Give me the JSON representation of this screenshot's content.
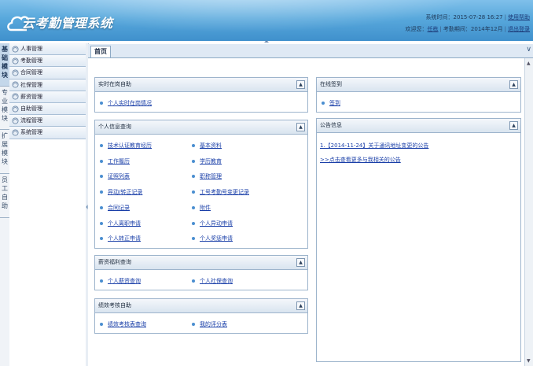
{
  "header": {
    "app_title": "云考勤管理系统",
    "system_time_label": "系统时间：",
    "system_time": "2015-07-28 16:27",
    "help_link": "使用帮助",
    "welcome_label": "欢迎您：",
    "user_name": "任栋",
    "period_label": "考勤期间：",
    "period": "2014年12月",
    "logout_link": "退出登录"
  },
  "left_tabs": [
    "基础模块",
    "专业模块",
    "扩展模块",
    "员工自助"
  ],
  "menu": {
    "items": [
      {
        "label": "人事管理",
        "icon": "folder-icon"
      },
      {
        "label": "考勤管理",
        "icon": "folder-icon"
      },
      {
        "label": "合同管理",
        "icon": "folder-icon"
      },
      {
        "label": "社保管理",
        "icon": "folder-icon"
      },
      {
        "label": "薪资管理",
        "icon": "folder-icon"
      },
      {
        "label": "自助管理",
        "icon": "folder-icon"
      },
      {
        "label": "流程管理",
        "icon": "folder-icon"
      },
      {
        "label": "系统管理",
        "icon": "folder-icon"
      }
    ]
  },
  "tabs": {
    "home": "首页"
  },
  "panels": {
    "realtime": {
      "title": "实时在岗自助",
      "links": [
        "个人实时在岗情况"
      ]
    },
    "personal_info": {
      "title": "个人信息查询",
      "links": [
        "技术认证教育经历",
        "基本资料",
        "工作履历",
        "学历教育",
        "证照列表",
        "职称管理",
        "异动/转正记录",
        "工号考勤号变更记录",
        "合同记录",
        "附件",
        "个人离职申请",
        "个人异动申请",
        "个人转正申请",
        "个人奖惩申请"
      ]
    },
    "salary": {
      "title": "薪资福利查询",
      "links": [
        "个人薪资查询",
        "个人社保查询"
      ]
    },
    "performance": {
      "title": "绩效考核自助",
      "links": [
        "绩效考核表查询",
        "我的评分表"
      ]
    },
    "signin": {
      "title": "在线签到",
      "links": [
        "签到"
      ]
    },
    "notice": {
      "title": "公告信息",
      "items": [
        "1.【2014-11-24】关于通讯地址变更的公告"
      ],
      "more": ">>点击查看更多与我相关的公告"
    }
  },
  "colors": {
    "header": "#4c9dd6",
    "link": "#1a3fa8",
    "panel_border": "#9db4cc"
  }
}
